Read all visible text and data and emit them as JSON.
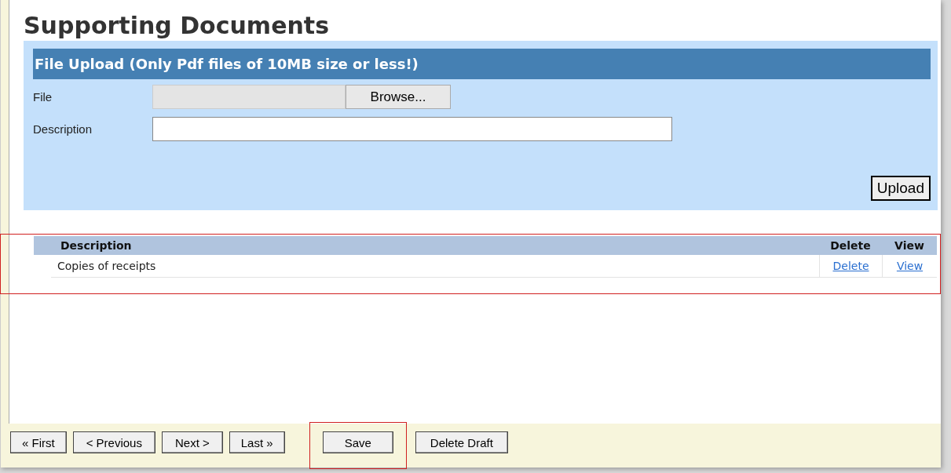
{
  "title": "Supporting Documents",
  "upload": {
    "header": "File Upload (Only Pdf files of 10MB size or less!)",
    "file_label": "File",
    "browse_button": "Browse...",
    "description_label": "Description",
    "upload_button": "Upload"
  },
  "table": {
    "highlighted": true,
    "columns": [
      "Description",
      "Delete",
      "View"
    ],
    "rows": [
      {
        "description": "Copies of receipts",
        "delete": "Delete",
        "view": "View"
      }
    ]
  },
  "nav_buttons": [
    {
      "label": "« First",
      "highlighted": false
    },
    {
      "label": "< Previous",
      "highlighted": false
    },
    {
      "label": "Next >",
      "highlighted": false
    },
    {
      "label": "Last »",
      "highlighted": false
    }
  ],
  "action_buttons": [
    {
      "label": "Save",
      "highlighted": true
    },
    {
      "label": "Delete Draft",
      "highlighted": false
    }
  ]
}
